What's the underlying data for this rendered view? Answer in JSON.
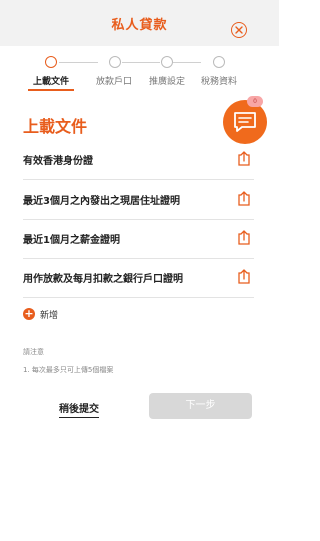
{
  "header": {
    "title": "私人貸款",
    "close_icon": "close-icon"
  },
  "steps": [
    {
      "label": "上載文件",
      "active": true
    },
    {
      "label": "放款戶口",
      "active": false
    },
    {
      "label": "推廣設定",
      "active": false
    },
    {
      "label": "稅務資料",
      "active": false
    }
  ],
  "chat": {
    "badge": "0",
    "icon": "chat-icon"
  },
  "section_title": "上載文件",
  "documents": [
    {
      "label": "有效香港身份證"
    },
    {
      "label": "最近3個月之內發出之現居住址證明"
    },
    {
      "label": "最近1個月之薪金證明"
    },
    {
      "label": "用作放款及每月扣款之銀行戶口證明"
    }
  ],
  "add": {
    "label": "新增",
    "symbol": "+"
  },
  "notes": {
    "title": "請注意",
    "item1": "1.  每次最多只可上傳5個檔案"
  },
  "actions": {
    "later": "稍後提交",
    "next": "下一步"
  },
  "colors": {
    "accent": "#e85d1d",
    "disabled": "#d8d8d8"
  }
}
